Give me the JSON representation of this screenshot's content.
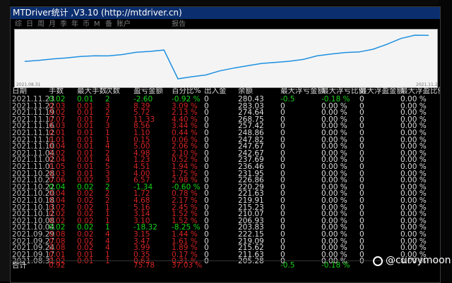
{
  "window": {
    "title": "MTDriver统计 ,V3.10 (http://mtdriver.cn)"
  },
  "toolbar": [
    "综",
    "日",
    "周",
    "月",
    "季",
    "年",
    "币",
    "M",
    "备",
    "账户",
    "报告"
  ],
  "chart_data": {
    "type": "line",
    "x_start_label": "2021.08.31",
    "x_end_label": "2021.11.23",
    "values": [
      0,
      0.31,
      0.74,
      1.02,
      1.44,
      1.62,
      1.61,
      1.98,
      2.65,
      2.9,
      3.28,
      -4.97,
      -4.37,
      -3.87,
      -2.7,
      -1.89,
      -1.22,
      -0.56,
      -0.25,
      0.07,
      0.6,
      1.62,
      2.14,
      2.58,
      2.74,
      3.5,
      4.93,
      6.59,
      7.53,
      7.46
    ],
    "color": "#1e90e0"
  },
  "table": {
    "headers": [
      "日期",
      "手数",
      "最大手数",
      "次数",
      "盈亏金额",
      "百分比%",
      "出入金",
      "余额",
      "最大浮亏金额",
      "最大浮亏比例",
      "最大浮盈金额",
      "最大浮盈比例"
    ],
    "rows": [
      {
        "date": "2021.11.23",
        "lots": "0.02",
        "maxlots": "0.01",
        "count": "2",
        "pnl": "-2.60",
        "pct": "-0.92 %",
        "flow": "0",
        "balance": "280.43",
        "fl_amt": "-0.5",
        "fl_pct": "-0.18 %",
        "fp_amt": "0",
        "fp_pct": "0.00 %",
        "win": false
      },
      {
        "date": "2021.11.22",
        "lots": "0.03",
        "maxlots": "0.01",
        "count": "3",
        "pnl": "8.39",
        "pct": "3.09 %",
        "flow": "0",
        "balance": "283.03",
        "fl_amt": "0",
        "fl_pct": "0.00 %",
        "fp_amt": "0",
        "fp_pct": "0.00 %",
        "win": true
      },
      {
        "date": "2021.11.19",
        "lots": "0.02",
        "maxlots": "0.01",
        "count": "2",
        "pnl": "5.72",
        "pct": "2.13 %",
        "flow": "0",
        "balance": "274.64",
        "fl_amt": "0",
        "fl_pct": "0.00 %",
        "fp_amt": "0",
        "fp_pct": "0.00 %",
        "win": true
      },
      {
        "date": "2021.11.17",
        "lots": "0.07",
        "maxlots": "0.01",
        "count": "7",
        "pnl": "11.33",
        "pct": "4.40 %",
        "flow": "0",
        "balance": "268.75",
        "fl_amt": "0",
        "fl_pct": "0.00 %",
        "fp_amt": "0",
        "fp_pct": "0.00 %",
        "win": true
      },
      {
        "date": "2021.11.16",
        "lots": "0.03",
        "maxlots": "0.01",
        "count": "3",
        "pnl": "8.56",
        "pct": "3.44 %",
        "flow": "0",
        "balance": "257.42",
        "fl_amt": "0",
        "fl_pct": "0.00 %",
        "fp_amt": "0",
        "fp_pct": "0.00 %",
        "win": true
      },
      {
        "date": "2021.11.12",
        "lots": "0.01",
        "maxlots": "0.01",
        "count": "1",
        "pnl": "1.10",
        "pct": "0.44 %",
        "flow": "0",
        "balance": "248.86",
        "fl_amt": "0",
        "fl_pct": "0.00 %",
        "fp_amt": "0",
        "fp_pct": "0.00 %",
        "win": true
      },
      {
        "date": "2021.11.11",
        "lots": "0.01",
        "maxlots": "0.01",
        "count": "1",
        "pnl": "0.15",
        "pct": "0.06 %",
        "flow": "0",
        "balance": "247.82",
        "fl_amt": "0",
        "fl_pct": "0.00 %",
        "fp_amt": "0",
        "fp_pct": "0.00 %",
        "win": true
      },
      {
        "date": "2021.11.10",
        "lots": "0.04",
        "maxlots": "0.01",
        "count": "4",
        "pnl": "5.00",
        "pct": "2.06 %",
        "flow": "0",
        "balance": "247.67",
        "fl_amt": "0",
        "fl_pct": "0.00 %",
        "fp_amt": "0",
        "fp_pct": "0.00 %",
        "win": true
      },
      {
        "date": "2021.11.04",
        "lots": "0.02",
        "maxlots": "0.01",
        "count": "2",
        "pnl": "4.98",
        "pct": "2.10 %",
        "flow": "0",
        "balance": "242.67",
        "fl_amt": "0",
        "fl_pct": "0.00 %",
        "fp_amt": "0",
        "fp_pct": "0.00 %",
        "win": true
      },
      {
        "date": "2021.11.02",
        "lots": "0.04",
        "maxlots": "0.01",
        "count": "4",
        "pnl": "1.23",
        "pct": "0.52 %",
        "flow": "0",
        "balance": "237.69",
        "fl_amt": "0",
        "fl_pct": "0.00 %",
        "fp_amt": "0",
        "fp_pct": "0.00 %",
        "win": true
      },
      {
        "date": "2021.11.01",
        "lots": "0.05",
        "maxlots": "0.01",
        "count": "5",
        "pnl": "4.51",
        "pct": "1.94 %",
        "flow": "0",
        "balance": "236.46",
        "fl_amt": "0",
        "fl_pct": "0.00 %",
        "fp_amt": "0",
        "fp_pct": "0.00 %",
        "win": true
      },
      {
        "date": "2021.10.28",
        "lots": "0.03",
        "maxlots": "0.01",
        "count": "3",
        "pnl": "4.00",
        "pct": "1.75 %",
        "flow": "0",
        "balance": "231.95",
        "fl_amt": "0",
        "fl_pct": "0.00 %",
        "fp_amt": "0",
        "fp_pct": "0.00 %",
        "win": true
      },
      {
        "date": "2021.10.27",
        "lots": "0.06",
        "maxlots": "0.02",
        "count": "3",
        "pnl": "6.57",
        "pct": "2.98 %",
        "flow": "0",
        "balance": "226.86",
        "fl_amt": "0",
        "fl_pct": "0.00 %",
        "fp_amt": "0",
        "fp_pct": "0.00 %",
        "win": true
      },
      {
        "date": "2021.10.22",
        "lots": "0.04",
        "maxlots": "0.02",
        "count": "2",
        "pnl": "-1.34",
        "pct": "-0.60 %",
        "flow": "0",
        "balance": "220.29",
        "fl_amt": "0",
        "fl_pct": "0.00 %",
        "fp_amt": "0",
        "fp_pct": "0.00 %",
        "win": false
      },
      {
        "date": "2021.10.20",
        "lots": "0.04",
        "maxlots": "0.02",
        "count": "2",
        "pnl": "1.72",
        "pct": "0.78 %",
        "flow": "0",
        "balance": "221.63",
        "fl_amt": "0",
        "fl_pct": "0.00 %",
        "fp_amt": "0",
        "fp_pct": "0.00 %",
        "win": true
      },
      {
        "date": "2021.10.18",
        "lots": "0.04",
        "maxlots": "0.02",
        "count": "2",
        "pnl": "4.68",
        "pct": "2.17 %",
        "flow": "0",
        "balance": "219.91",
        "fl_amt": "0",
        "fl_pct": "0.00 %",
        "fp_amt": "0",
        "fp_pct": "0.00 %",
        "win": true
      },
      {
        "date": "2021.10.13",
        "lots": "0.02",
        "maxlots": "0.02",
        "count": "1",
        "pnl": "5.16",
        "pct": "2.45 %",
        "flow": "0",
        "balance": "215.23",
        "fl_amt": "0",
        "fl_pct": "0.00 %",
        "fp_amt": "0",
        "fp_pct": "0.00 %",
        "win": true
      },
      {
        "date": "2021.10.12",
        "lots": "0.02",
        "maxlots": "0.02",
        "count": "1",
        "pnl": "3.14",
        "pct": "1.52 %",
        "flow": "0",
        "balance": "210.07",
        "fl_amt": "0",
        "fl_pct": "0.00 %",
        "fp_amt": "0",
        "fp_pct": "0.00 %",
        "win": true
      },
      {
        "date": "2021.10.08",
        "lots": "0.02",
        "maxlots": "0.02",
        "count": "1",
        "pnl": "3.10",
        "pct": "1.52 %",
        "flow": "0",
        "balance": "206.93",
        "fl_amt": "0",
        "fl_pct": "0.00 %",
        "fp_amt": "0",
        "fp_pct": "0.00 %",
        "win": true
      },
      {
        "date": "2021.10.04",
        "lots": "0.02",
        "maxlots": "0.02",
        "count": "1",
        "pnl": "-18.32",
        "pct": "-8.25 %",
        "flow": "0",
        "balance": "203.83",
        "fl_amt": "0",
        "fl_pct": "0.00 %",
        "fp_amt": "0",
        "fp_pct": "0.00 %",
        "win": false
      },
      {
        "date": "2021.09.29",
        "lots": "0.08",
        "maxlots": "0.02",
        "count": "4",
        "pnl": "3.15",
        "pct": "1.44 %",
        "flow": "0",
        "balance": "222.15",
        "fl_amt": "0",
        "fl_pct": "0.00 %",
        "fp_amt": "0",
        "fp_pct": "0.00 %",
        "win": true
      },
      {
        "date": "2021.09.27",
        "lots": "0.08",
        "maxlots": "0.02",
        "count": "4",
        "pnl": "3.47",
        "pct": "1.61 %",
        "flow": "0",
        "balance": "219.09",
        "fl_amt": "0",
        "fl_pct": "0.00 %",
        "fp_amt": "0",
        "fp_pct": "0.00 %",
        "win": true
      },
      {
        "date": "2021.09.24",
        "lots": "0.08",
        "maxlots": "0.02",
        "count": "4",
        "pnl": "3.99",
        "pct": "1.89 %",
        "flow": "0",
        "balance": "215.62",
        "fl_amt": "0",
        "fl_pct": "0.00 %",
        "fp_amt": "0",
        "fp_pct": "0.00 %",
        "win": true
      },
      {
        "date": "2021.09.17",
        "lots": "0.01",
        "maxlots": "0.01",
        "count": "1",
        "pnl": "0.35",
        "pct": "0.17 %",
        "flow": "0",
        "balance": "211.63",
        "fl_amt": "0",
        "fl_pct": "0.00 %",
        "fp_amt": "0",
        "fp_pct": "0.00 %",
        "win": true
      },
      {
        "date": "2021.08.31",
        "lots": "0.02",
        "maxlots": "0.01",
        "count": "1",
        "pnl": "0.63",
        "pct": "0.31 %",
        "flow": "0",
        "balance": "205.28",
        "fl_amt": "0",
        "fl_pct": "0.00 %",
        "fp_amt": "0",
        "fp_pct": "0.00 %",
        "win": true
      }
    ],
    "total": {
      "label": "合计",
      "lots": "0.92",
      "pnl": "75.78",
      "pct": "37.03 %",
      "fl_amt": "-0.5",
      "fl_pct": "-0.18 %"
    }
  },
  "watermark": "@curvymoon",
  "colors": {
    "title_bar": "#0b2e6e",
    "profit": "#d42424",
    "loss": "#19d119",
    "line": "#1e90e0"
  }
}
